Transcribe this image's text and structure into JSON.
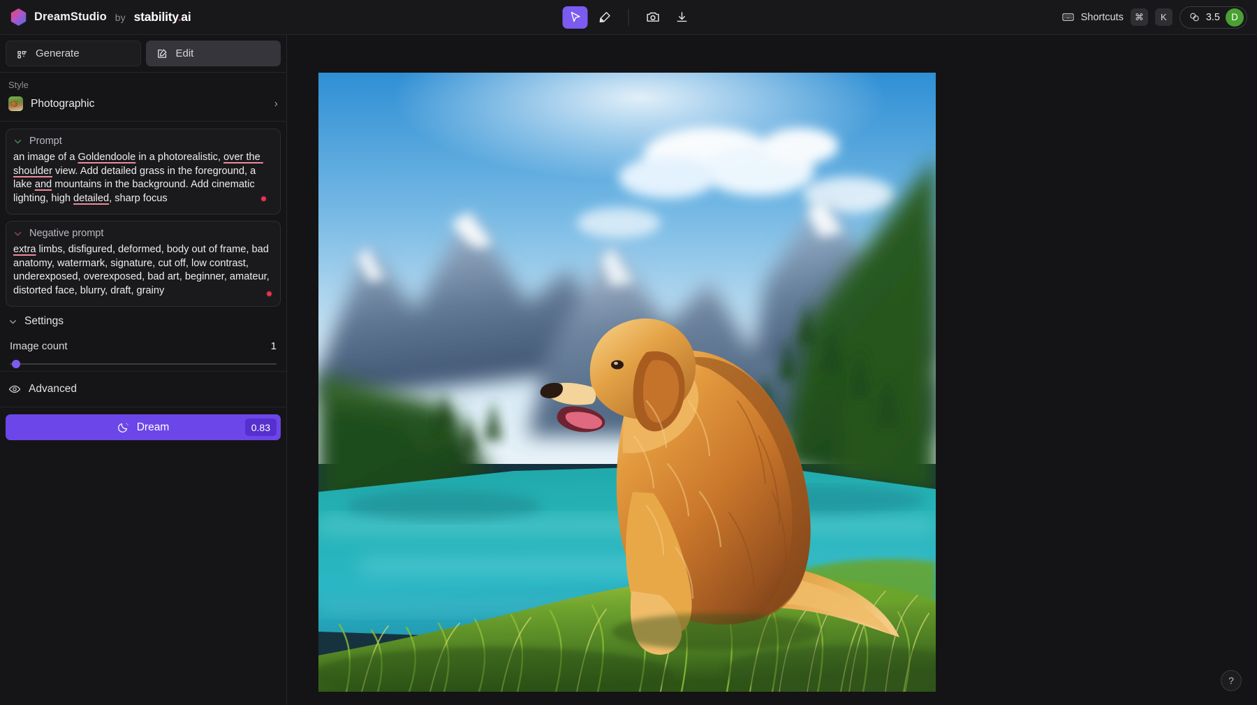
{
  "app": {
    "brand_name": "DreamStudio",
    "brand_by": "by",
    "brand_vendor": "stability",
    "brand_vendor_dot": ".",
    "brand_vendor_tld": "ai",
    "logo_icon": "hexagon-gradient-logo"
  },
  "toolbar": {
    "tools": [
      {
        "name": "cursor-tool",
        "icon": "cursor-icon",
        "active": true
      },
      {
        "name": "eraser-tool",
        "icon": "eraser-icon",
        "active": false
      },
      {
        "name": "camera-tool",
        "icon": "camera-icon",
        "active": false
      },
      {
        "name": "download-tool",
        "icon": "download-icon",
        "active": false
      }
    ]
  },
  "header_right": {
    "shortcuts_label": "Shortcuts",
    "shortcuts_icon": "keyboard-icon",
    "key_modifier": "⌘",
    "key_letter": "K",
    "credits_icon": "coins-icon",
    "credits_value": "3.5",
    "avatar_initial": "D",
    "avatar_color": "#4aa032"
  },
  "sidebar": {
    "tabs": [
      {
        "label": "Generate",
        "icon": "grid-dots-icon",
        "selected": false
      },
      {
        "label": "Edit",
        "icon": "pencil-square-icon",
        "selected": true
      }
    ],
    "style": {
      "section_label": "Style",
      "value": "Photographic",
      "thumb_icon": "style-thumbnail",
      "chevron_icon": "chevron-right-icon"
    },
    "prompt": {
      "title": "Prompt",
      "caret_icon": "chevron-down-icon",
      "text": "an image of a Goldendoole in a photorealistic, over the shoulder view. Add detailed grass in the foreground, a lake and mountains in the background. Add cinematic lighting, high detailed, sharp focus",
      "spellcheck_terms": [
        "Goldendoole",
        "over the shoulder",
        "and",
        "detailed"
      ],
      "grammar_dot_color": "#e8344f"
    },
    "negative_prompt": {
      "title": "Negative prompt",
      "caret_icon": "chevron-down-icon",
      "text": "extra limbs, disfigured, deformed, body out of frame, bad anatomy, watermark, signature, cut off, low contrast, underexposed, overexposed, bad art, beginner, amateur, distorted face, blurry, draft, grainy",
      "spellcheck_terms": [
        "extra"
      ],
      "grammar_dot_color": "#e8344f"
    },
    "settings": {
      "title": "Settings",
      "caret_icon": "chevron-down-icon",
      "image_count_label": "Image count",
      "image_count_value": "1",
      "slider_percent": 2,
      "slider_color": "#7c5cf0"
    },
    "advanced": {
      "label": "Advanced",
      "icon": "eye-icon"
    },
    "dream_button": {
      "label": "Dream",
      "icon": "moon-icon",
      "cost": "0.83",
      "color": "#6c46e8"
    }
  },
  "canvas": {
    "image_alt": "golden retriever dog sitting on grass by a turquoise lake with mountains",
    "help_label": "?"
  }
}
